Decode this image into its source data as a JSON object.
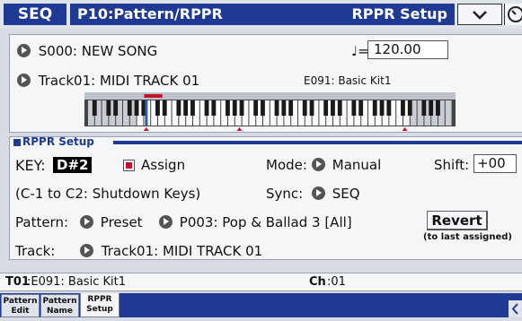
{
  "header": {
    "mode": "SEQ",
    "page_title": "P10:Pattern/RPPR",
    "page_tab": "RPPR Setup",
    "menu_icon": "chevron-down-icon",
    "corner_icon": "clock-icon"
  },
  "song": {
    "name": "S000: NEW SONG",
    "tempo_symbol": "♩=",
    "tempo": "120.00"
  },
  "track": {
    "name": "Track01: MIDI TRACK 01",
    "program": "E091: Basic Kit1"
  },
  "keyboard": {
    "highlight_color": "#c8102e"
  },
  "rppr": {
    "section_title": "RPPR Setup",
    "key_label": "KEY:",
    "key_value": "D#2",
    "assign_label": "Assign",
    "assign_checked": true,
    "mode_label": "Mode:",
    "mode_value": "Manual",
    "shift_label": "Shift:",
    "shift_value": "+00",
    "shutdown_text": "(C-1 to C2: Shutdown Keys)",
    "sync_label": "Sync:",
    "sync_value": "SEQ",
    "pattern_label": "Pattern:",
    "pattern_bank": "Preset",
    "pattern_value": "P003: Pop & Ballad 3 [All]",
    "revert_label": "Revert",
    "revert_sub": "(to last assigned)",
    "track_label": "Track:",
    "track_value": "Track01: MIDI TRACK 01"
  },
  "status": {
    "track": "T01",
    "program": ":E091: Basic Kit1",
    "ch_label": "Ch",
    "ch_value": ":01"
  },
  "tabs": [
    {
      "line1": "Pattern",
      "line2": "Edit"
    },
    {
      "line1": "Pattern",
      "line2": "Name"
    },
    {
      "line1": "RPPR",
      "line2": "Setup"
    }
  ],
  "colors": {
    "accent": "#1e3a92",
    "panel": "#f5f6f8",
    "background": "#d8dce4"
  }
}
